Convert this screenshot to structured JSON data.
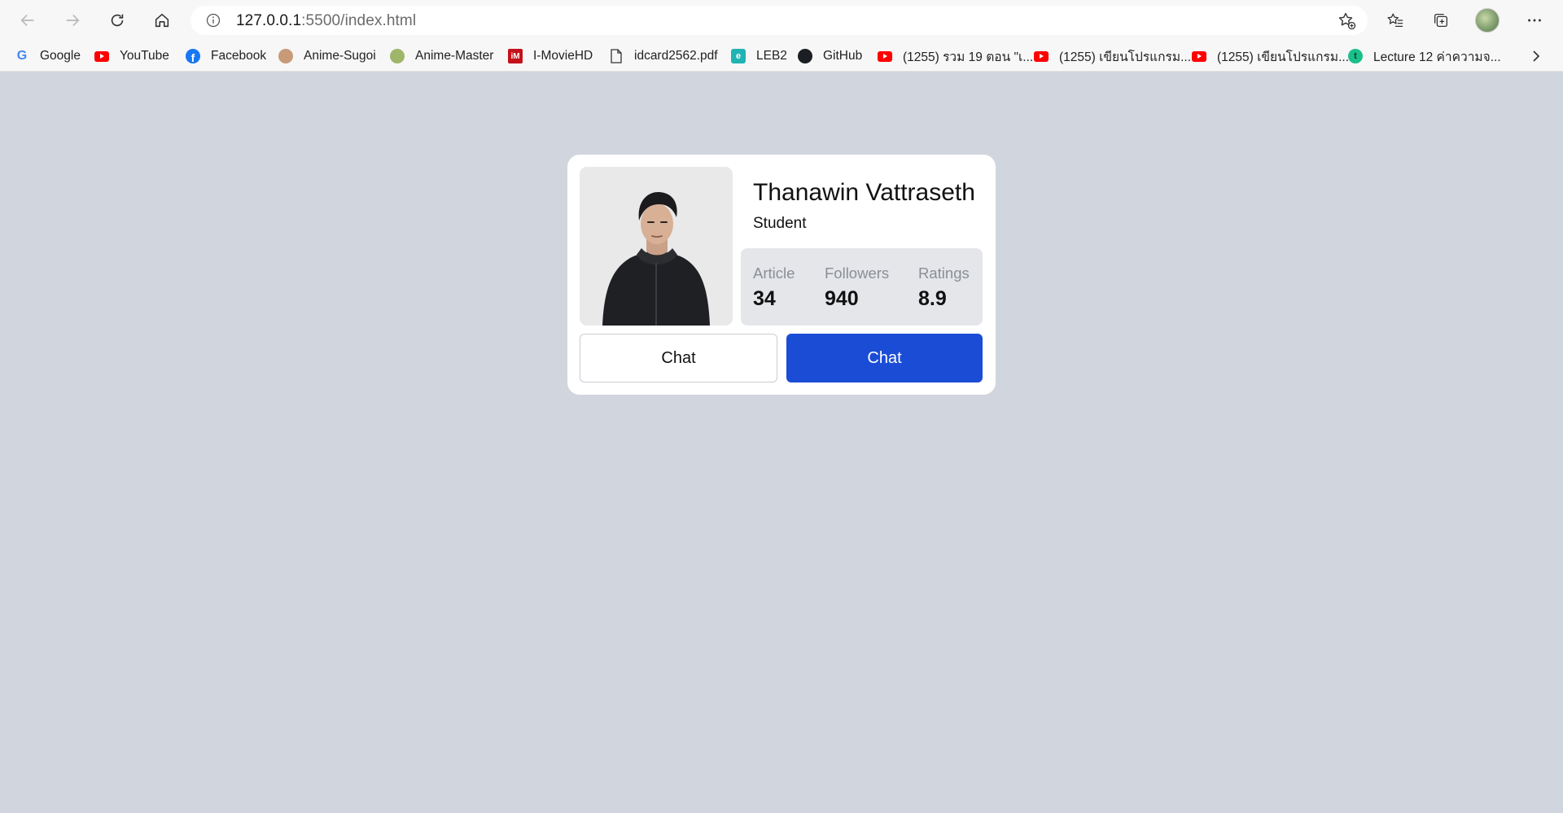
{
  "browser": {
    "url_host": "127.0.0.1",
    "url_rest": ":5500/index.html",
    "icons": {
      "back": "arrow-left-icon",
      "forward": "arrow-right-icon",
      "reload": "reload-icon",
      "home": "home-icon",
      "site_info": "info-icon",
      "add_favorite": "star-plus-icon",
      "favorites": "favorites-icon",
      "collections": "collections-icon",
      "menu": "ellipsis-icon"
    }
  },
  "bookmarks": [
    {
      "label": "Google",
      "icon": "google-icon"
    },
    {
      "label": "YouTube",
      "icon": "youtube-icon"
    },
    {
      "label": "Facebook",
      "icon": "facebook-icon"
    },
    {
      "label": "Anime-Sugoi",
      "icon": "anime-sugoi-icon"
    },
    {
      "label": "Anime-Master",
      "icon": "anime-master-icon"
    },
    {
      "label": "I-MovieHD",
      "icon": "imoviehd-icon"
    },
    {
      "label": "idcard2562.pdf",
      "icon": "file-icon"
    },
    {
      "label": "LEB2",
      "icon": "leb2-icon"
    },
    {
      "label": "GitHub",
      "icon": "github-icon"
    },
    {
      "label": "(1255) รวม 19 ตอน \"เ...",
      "icon": "youtube-icon"
    },
    {
      "label": "(1255) เขียนโปรแกรม...",
      "icon": "youtube-icon"
    },
    {
      "label": "(1255) เขียนโปรแกรม...",
      "icon": "youtube-icon"
    },
    {
      "label": "Lecture 12 ค่าความจ...",
      "icon": "lecture-icon"
    }
  ],
  "profile": {
    "name": "Thanawin Vattraseth",
    "role": "Student",
    "stats": [
      {
        "label": "Article",
        "value": "34"
      },
      {
        "label": "Followers",
        "value": "940"
      },
      {
        "label": "Ratings",
        "value": "8.9"
      }
    ],
    "buttons": {
      "secondary_label": "Chat",
      "primary_label": "Chat"
    }
  },
  "colors": {
    "page_background": "#d1d5de",
    "primary_button": "#1b4cd6",
    "stats_background": "#e4e6ea"
  }
}
